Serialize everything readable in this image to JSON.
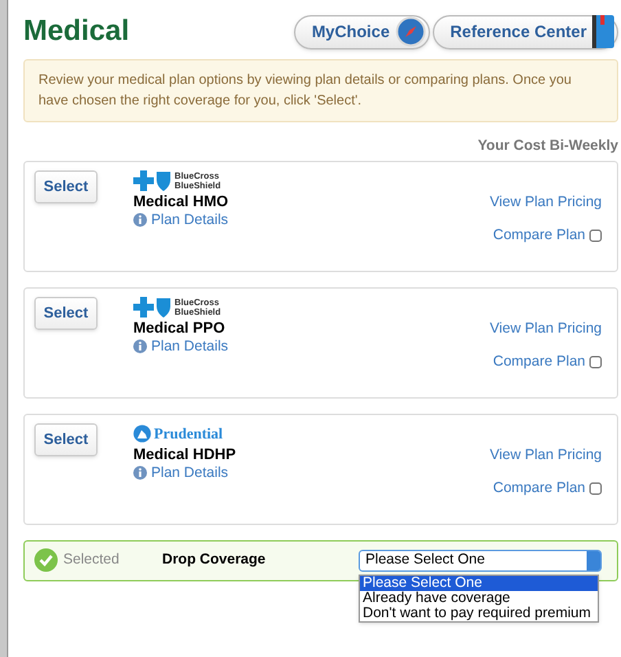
{
  "title": "Medical",
  "header_buttons": [
    {
      "label": "MyChoice",
      "kind": "compass"
    },
    {
      "label": "Reference Center",
      "kind": "book"
    }
  ],
  "notice": "Review your medical plan options by viewing plan details or comparing plans. Once you have chosen the right coverage for you, click 'Select'.",
  "cost_heading": "Your Cost Bi-Weekly",
  "plans": [
    {
      "select_label": "Select",
      "carrier": {
        "kind": "bcbs",
        "lines": [
          "BlueCross",
          "BlueShield"
        ]
      },
      "name": "Medical HMO",
      "details_link": "Plan Details",
      "pricing_link": "View Plan Pricing",
      "compare_label": "Compare Plan",
      "compare_checked": false
    },
    {
      "select_label": "Select",
      "carrier": {
        "kind": "bcbs",
        "lines": [
          "BlueCross",
          "BlueShield"
        ]
      },
      "name": "Medical PPO",
      "details_link": "Plan Details",
      "pricing_link": "View Plan Pricing",
      "compare_label": "Compare Plan",
      "compare_checked": false
    },
    {
      "select_label": "Select",
      "carrier": {
        "kind": "prudential",
        "lines": [
          "Prudential"
        ]
      },
      "name": "Medical HDHP",
      "details_link": "Plan Details",
      "pricing_link": "View Plan Pricing",
      "compare_label": "Compare Plan",
      "compare_checked": false
    }
  ],
  "drop": {
    "selected": true,
    "status": "Selected",
    "name": "Drop Coverage",
    "dropdown": {
      "value": "Please Select One",
      "expanded": true,
      "options": [
        {
          "label": "Please Select One",
          "selected": true
        },
        {
          "label": "Already have coverage",
          "selected": false
        },
        {
          "label": "Don't want to pay required premium",
          "selected": false
        }
      ]
    }
  }
}
